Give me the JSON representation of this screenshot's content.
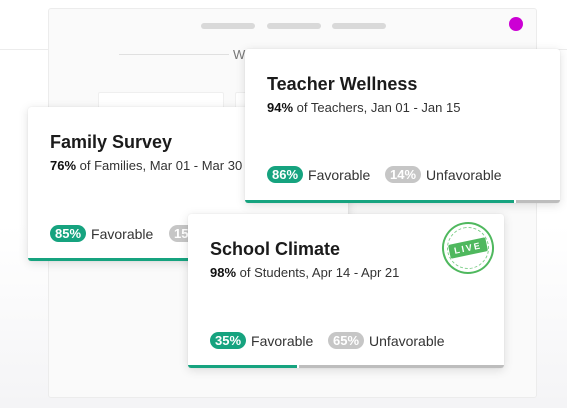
{
  "background_window": {
    "title": "W"
  },
  "cards": {
    "teacher": {
      "title": "Teacher Wellness",
      "pct": "94%",
      "desc": " of Teachers, Jan 01 - Jan 15",
      "favorable_pct": "86%",
      "favorable_label": "Favorable",
      "unfavorable_pct": "14%",
      "unfavorable_label": "Unfavorable",
      "favorable_value": 86
    },
    "family": {
      "title": "Family Survey",
      "pct": "76%",
      "desc": " of Families, Mar 01 - Mar 30",
      "favorable_pct": "85%",
      "favorable_label": "Favorable",
      "unfavorable_pct": "15%",
      "favorable_value": 85
    },
    "school": {
      "title": "School Climate",
      "pct": "98%",
      "desc": " of Students, Apr 14 - Apr 21",
      "favorable_pct": "35%",
      "favorable_label": "Favorable",
      "unfavorable_pct": "65%",
      "unfavorable_label": "Unfavorable",
      "favorable_value": 35,
      "live_label": "LIVE"
    }
  },
  "colors": {
    "favorable": "#16a37f",
    "unfavorable": "#c6c6c6",
    "accent_dot": "#cc00d4",
    "live": "#4fb85e"
  }
}
